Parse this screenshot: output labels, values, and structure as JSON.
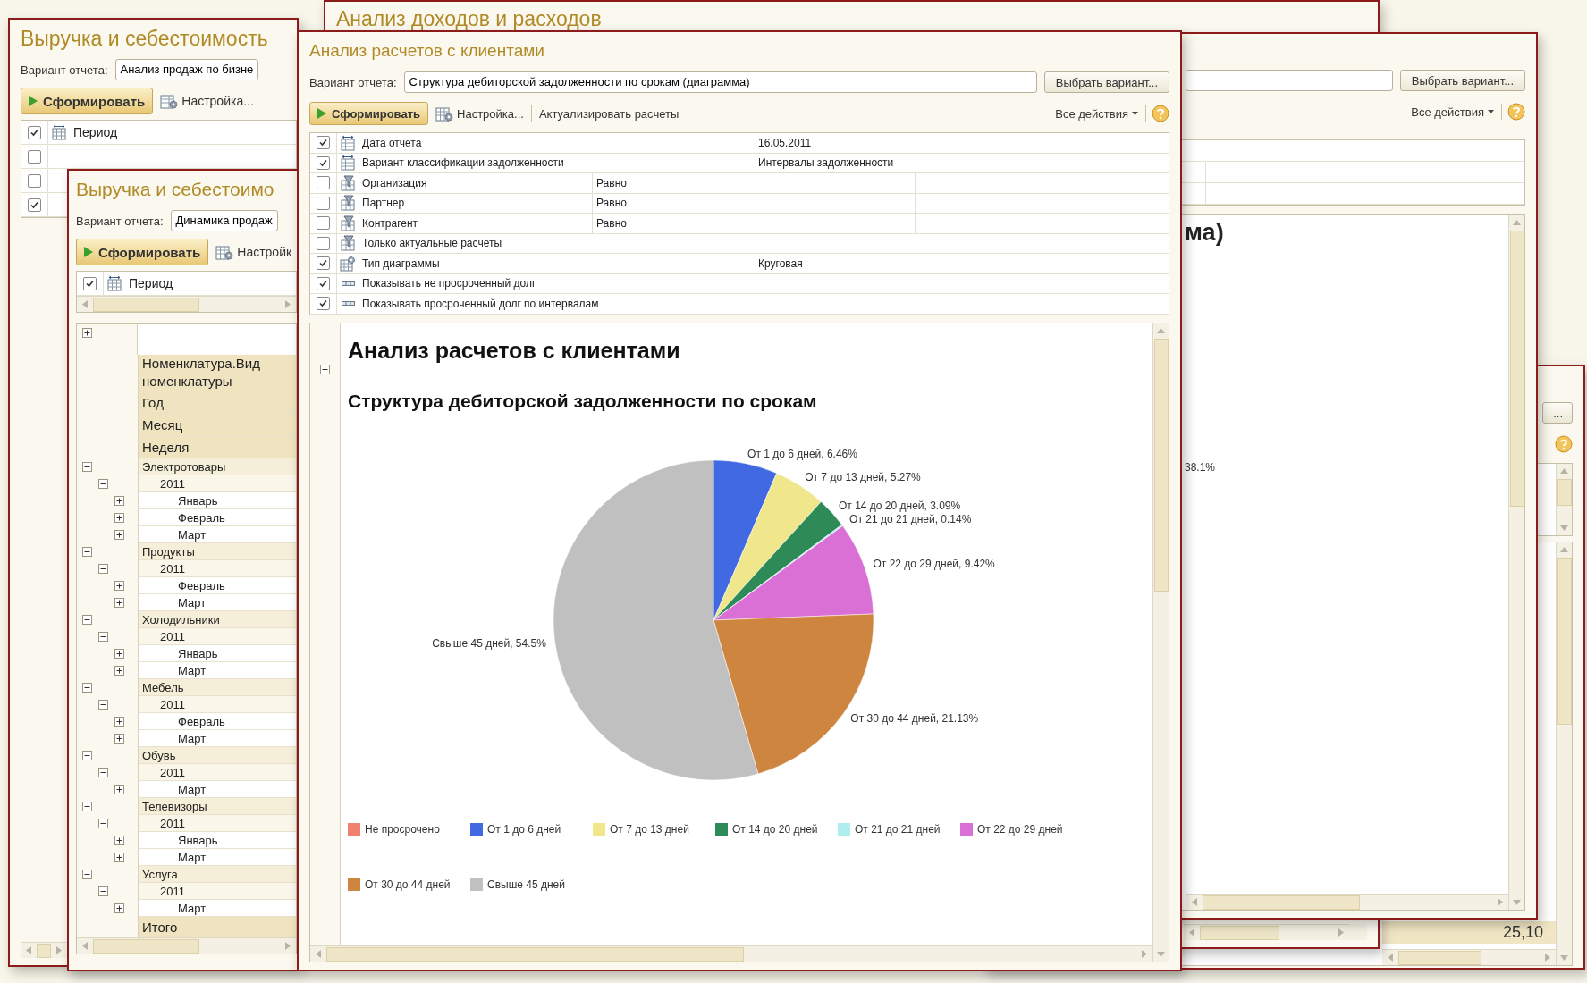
{
  "window_left": {
    "title": "Выручка и себестоимость",
    "variant_label": "Вариант отчета:",
    "variant_value": "Анализ продаж по бизне",
    "generate_button": "Сформировать",
    "settings_button": "Настройка...",
    "settings_rows": [
      {
        "checked": true,
        "kind": "period",
        "name": "Период"
      },
      {
        "checked": false
      },
      {
        "checked": false
      },
      {
        "checked": true
      }
    ]
  },
  "window_top": {
    "title": "Анализ доходов и расходов"
  },
  "window_bottom_right": {
    "choose_button": "...",
    "total_cell": "25,10"
  },
  "window_right": {
    "choose_button": "Выбрать вариант...",
    "all_actions": "Все действия",
    "heading_fragment": "ма)",
    "label_fragment": "38.1%"
  },
  "window_middle": {
    "title": "Выручка и себестоимо",
    "variant_label": "Вариант отчета:",
    "variant_value": "Динамика продаж",
    "generate_button": "Сформировать",
    "settings_button": "Настройк",
    "settings_rows": [
      {
        "checked": true,
        "kind": "period",
        "name": "Период"
      }
    ],
    "report": {
      "header_rows": [
        "Номенклатура.Вид номенклатуры",
        "Год",
        "Месяц",
        "Неделя"
      ],
      "tree": [
        {
          "label": "Электротовары",
          "expanded": true,
          "children": [
            {
              "label": "2011",
              "expanded": true,
              "children": [
                {
                  "label": "Январь",
                  "expanded": false
                },
                {
                  "label": "Февраль",
                  "expanded": false
                },
                {
                  "label": "Март",
                  "expanded": false
                }
              ]
            }
          ]
        },
        {
          "label": "Продукты",
          "expanded": true,
          "children": [
            {
              "label": "2011",
              "expanded": true,
              "children": [
                {
                  "label": "Февраль",
                  "expanded": false
                },
                {
                  "label": "Март",
                  "expanded": false
                }
              ]
            }
          ]
        },
        {
          "label": "Холодильники",
          "expanded": true,
          "children": [
            {
              "label": "2011",
              "expanded": true,
              "children": [
                {
                  "label": "Январь",
                  "expanded": false
                },
                {
                  "label": "Март",
                  "expanded": false
                }
              ]
            }
          ]
        },
        {
          "label": "Мебель",
          "expanded": true,
          "children": [
            {
              "label": "2011",
              "expanded": true,
              "children": [
                {
                  "label": "Февраль",
                  "expanded": false
                },
                {
                  "label": "Март",
                  "expanded": false
                }
              ]
            }
          ]
        },
        {
          "label": "Обувь",
          "expanded": true,
          "children": [
            {
              "label": "2011",
              "expanded": true,
              "children": [
                {
                  "label": "Март",
                  "expanded": false
                }
              ]
            }
          ]
        },
        {
          "label": "Телевизоры",
          "expanded": true,
          "children": [
            {
              "label": "2011",
              "expanded": true,
              "children": [
                {
                  "label": "Январь",
                  "expanded": false
                },
                {
                  "label": "Март",
                  "expanded": false
                }
              ]
            }
          ]
        },
        {
          "label": "Услуга",
          "expanded": true,
          "children": [
            {
              "label": "2011",
              "expanded": true,
              "children": [
                {
                  "label": "Март",
                  "expanded": false
                }
              ]
            }
          ]
        }
      ],
      "total": "Итого"
    }
  },
  "main_window": {
    "title": "Анализ расчетов с клиентами",
    "variant_label": "Вариант отчета:",
    "variant_value": "Структура дебиторской задолженности по срокам (диаграмма)",
    "choose_button": "Выбрать вариант...",
    "generate_button": "Сформировать",
    "settings_button": "Настройка...",
    "refresh_button": "Актуализировать расчеты",
    "all_actions": "Все действия",
    "settings_rows": [
      {
        "checked": true,
        "kind": "period",
        "name": "Дата отчета",
        "value": "16.05.2011"
      },
      {
        "checked": true,
        "kind": "period",
        "name": "Вариант классификации задолженности",
        "value": "Интервалы задолженности"
      },
      {
        "checked": false,
        "kind": "filter",
        "name": "Организация",
        "condition": "Равно"
      },
      {
        "checked": false,
        "kind": "filter",
        "name": "Партнер",
        "condition": "Равно"
      },
      {
        "checked": false,
        "kind": "filter",
        "name": "Контрагент",
        "condition": "Равно"
      },
      {
        "checked": false,
        "kind": "filter",
        "name": "Только актуальные расчеты"
      },
      {
        "checked": true,
        "kind": "chart_type",
        "name": "Тип диаграммы",
        "value": "Круговая"
      },
      {
        "checked": true,
        "kind": "flag",
        "name": "Показывать не просроченный долг"
      },
      {
        "checked": true,
        "kind": "flag",
        "name": "Показывать просроченный долг по интервалам"
      }
    ],
    "report": {
      "title": "Анализ расчетов с клиентами",
      "chart_data": {
        "type": "pie",
        "title": "Структура дебиторской задолженности по срокам",
        "categories": [
          "Не просрочено",
          "От 1 до 6 дней",
          "От 7 до 13 дней",
          "От 14 до 20 дней",
          "От 21 до 21 дней",
          "От 22 до 29 дней",
          "От 30 до 44 дней",
          "Свыше 45 дней"
        ],
        "values": [
          0,
          6.46,
          5.27,
          3.09,
          0.14,
          9.42,
          21.13,
          54.5
        ],
        "legend": "bottom",
        "value_labels": [
          null,
          "От 1 до 6 дней, 6.46%",
          "От 7 до 13 дней, 5.27%",
          "От 14 до 20 дней, 3.09%",
          "От 21 до 21 дней, 0.14%",
          "От 22 до 29 дней, 9.42%",
          "От 30 до 44 дней, 21.13%",
          "Свыше 45 дней, 54.5%"
        ]
      },
      "legend_items": [
        {
          "color": "#f08070"
        },
        {
          "color": "#4169e1"
        },
        {
          "color": "#f0e68c"
        },
        {
          "color": "#2e8b57"
        },
        {
          "color": "#afeeee"
        },
        {
          "color": "#da70d6"
        },
        {
          "color": "#cd853f"
        },
        {
          "color": "#c0c0c0"
        }
      ]
    }
  }
}
